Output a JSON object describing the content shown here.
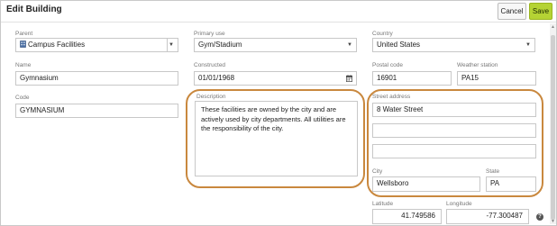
{
  "dialog": {
    "title": "Edit Building",
    "cancel_label": "Cancel",
    "save_label": "Save"
  },
  "form": {
    "parent": {
      "label": "Parent",
      "value": "Campus Facilities"
    },
    "primary_use": {
      "label": "Primary use",
      "value": "Gym/Stadium"
    },
    "country": {
      "label": "Country",
      "value": "United States"
    },
    "name": {
      "label": "Name",
      "value": "Gymnasium"
    },
    "constructed": {
      "label": "Constructed",
      "value": "01/01/1968"
    },
    "postal_code": {
      "label": "Postal code",
      "value": "16901"
    },
    "weather_station": {
      "label": "Weather station",
      "value": "PA15"
    },
    "code": {
      "label": "Code",
      "value": "GYMNASIUM"
    },
    "description": {
      "label": "Description",
      "value": "These facilities are owned by the city and are actively used by city departments. All utilities are the responsibility of the city."
    },
    "street_address": {
      "label": "Street address",
      "line1": "8 Water Street",
      "line2": "",
      "line3": ""
    },
    "city": {
      "label": "City",
      "value": "Wellsboro"
    },
    "state": {
      "label": "State",
      "value": "PA"
    },
    "latitude": {
      "label": "Latitude",
      "value": "41.749586"
    },
    "longitude": {
      "label": "Longitude",
      "value": "-77.300487"
    }
  },
  "icons": {
    "building": "building-icon",
    "calendar": "calendar-icon",
    "help": "help-icon",
    "chevron": "chevron-down-icon"
  },
  "colors": {
    "save_button": "#b5d334",
    "highlight_outline": "#c9883e"
  }
}
